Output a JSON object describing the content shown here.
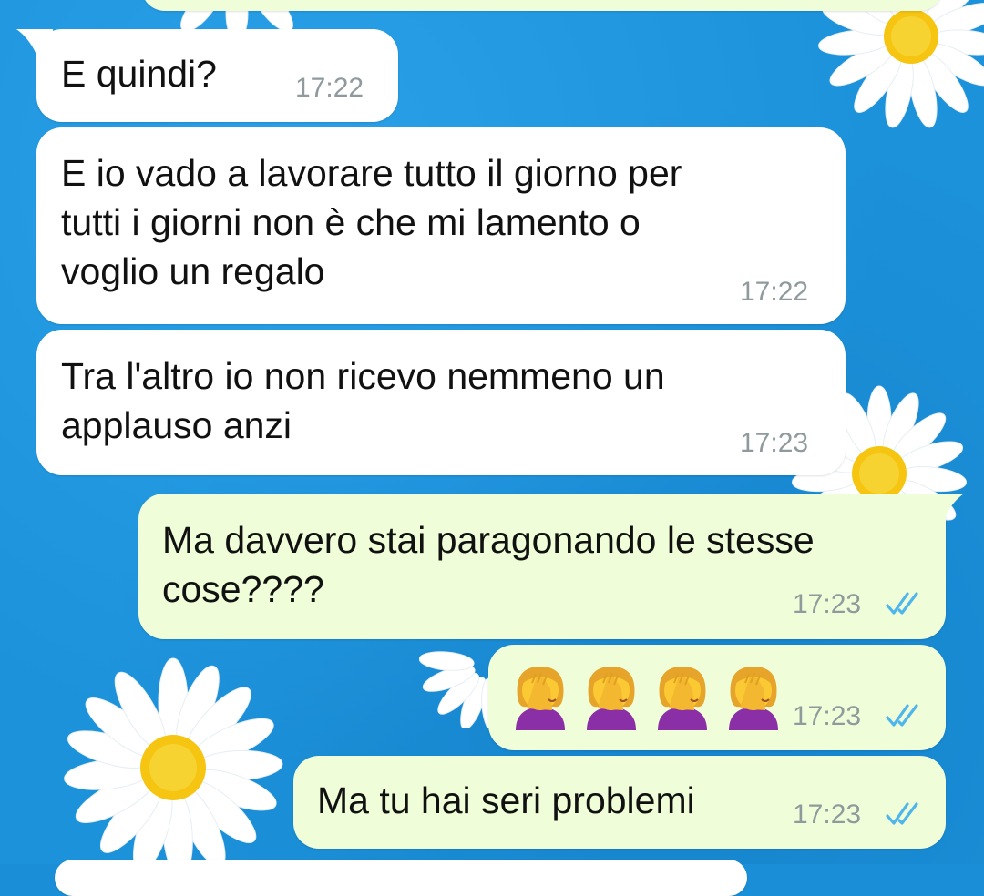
{
  "chat": {
    "messages": [
      {
        "direction": "incoming",
        "text": "E quindi?",
        "time": "17:22"
      },
      {
        "direction": "incoming",
        "text": "E io vado a lavorare tutto il giorno per\ntutti i giorni non è che mi lamento o\nvoglio un regalo",
        "time": "17:22"
      },
      {
        "direction": "incoming",
        "text": "Tra l'altro io non ricevo nemmeno un\napplauso anzi",
        "time": "17:23"
      },
      {
        "direction": "outgoing",
        "text": "Ma davvero stai paragonando le stesse\ncose????",
        "time": "17:23",
        "status": "read"
      },
      {
        "direction": "outgoing",
        "emoji": [
          "woman-facepalming",
          "woman-facepalming",
          "woman-facepalming",
          "woman-facepalming"
        ],
        "time": "17:23",
        "status": "read"
      },
      {
        "direction": "outgoing",
        "text": "Ma tu hai seri problemi",
        "time": "17:23",
        "status": "read"
      }
    ]
  },
  "colors": {
    "wallpaper": "#1c92da",
    "incoming_bubble": "#ffffff",
    "outgoing_bubble": "#effed8",
    "read_ticks": "#4fb6ec",
    "timestamp": "#8f9a9c"
  },
  "icons": {
    "read_receipt": "double-check-icon",
    "wallpaper_decoration": "daisy-flower"
  }
}
